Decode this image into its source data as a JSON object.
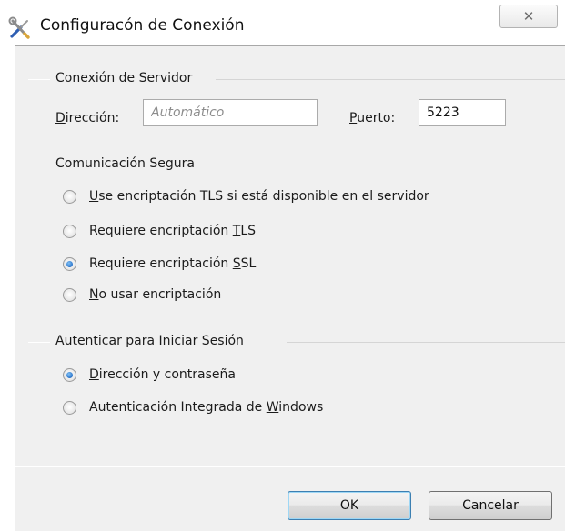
{
  "window": {
    "title": "Configuracón de Conexión",
    "icon": "tools-icon",
    "close_glyph": "✕"
  },
  "server_group": {
    "title": "Conexión de Servidor",
    "address_label_accel": "D",
    "address_label_rest": "irección:",
    "address_placeholder": "Automático",
    "address_value": "",
    "port_label_accel": "P",
    "port_label_rest": "uerto:",
    "port_value": "5223"
  },
  "secure_group": {
    "title": "Comunicación Segura",
    "options": [
      {
        "pre": "",
        "accel": "U",
        "post": "se encriptación TLS si está disponible en el servidor",
        "checked": false
      },
      {
        "pre": "Requiere encriptación ",
        "accel": "T",
        "post": "LS",
        "checked": false
      },
      {
        "pre": "Requiere encriptación ",
        "accel": "S",
        "post": "SL",
        "checked": true
      },
      {
        "pre": "",
        "accel": "N",
        "post": "o usar encriptación",
        "checked": false
      }
    ]
  },
  "auth_group": {
    "title": "Autenticar para Iniciar Sesión",
    "options": [
      {
        "pre": "",
        "accel": "D",
        "post": "irección y contraseña",
        "checked": true
      },
      {
        "pre": "Autenticación Integrada de ",
        "accel": "W",
        "post": "indows",
        "checked": false
      }
    ]
  },
  "buttons": {
    "ok_label": "OK",
    "cancel_label": "Cancelar"
  }
}
